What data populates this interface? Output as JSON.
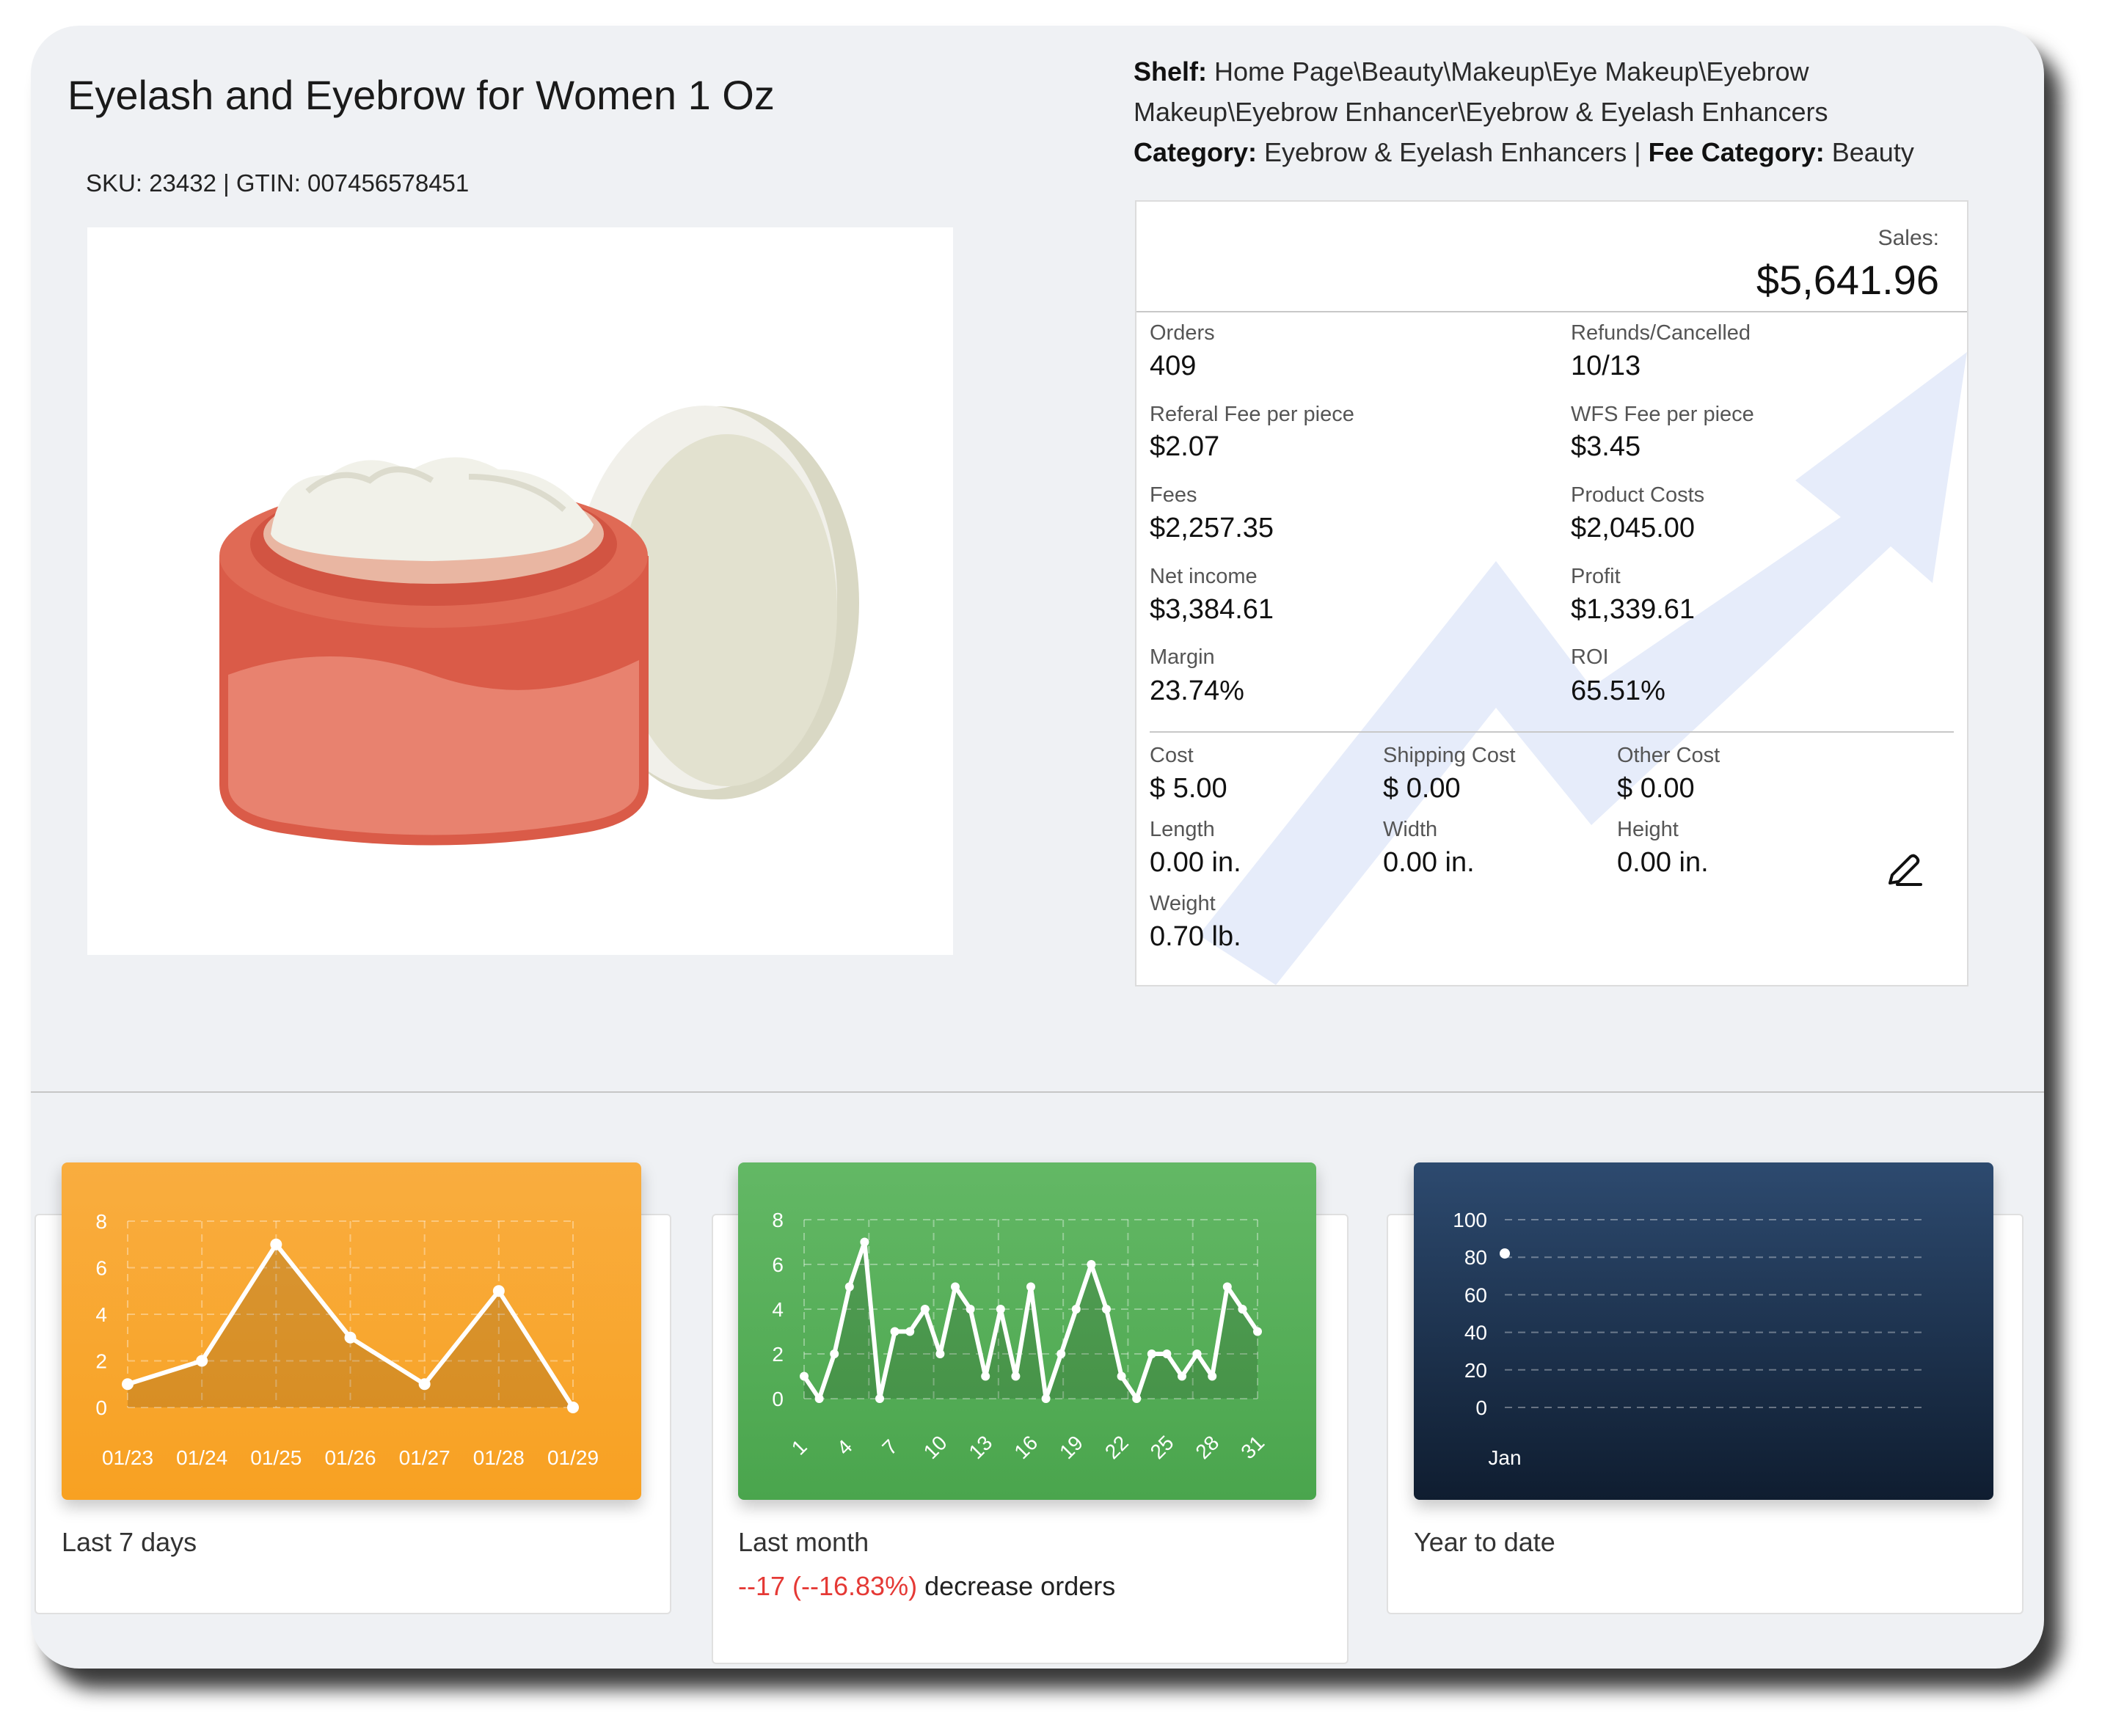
{
  "product": {
    "title": "Eyelash and Eyebrow for Women 1 Oz",
    "sku_line": "SKU: 23432 | GTIN: 007456578451",
    "image_icon": "cosmetic-jar-icon"
  },
  "shelf": {
    "shelf_label": "Shelf:",
    "shelf_value_1": " Home Page\\Beauty\\Makeup\\Eye Makeup\\Eyebrow",
    "shelf_value_2": "Makeup\\Eyebrow Enhancer\\Eyebrow & Eyelash Enhancers",
    "category_label": "Category:",
    "category_value": " Eyebrow & Eyelash Enhancers | ",
    "fee_category_label": "Fee Category:",
    "fee_category_value": " Beauty"
  },
  "stats": {
    "sales_label": "Sales:",
    "sales_value": "$5,641.96",
    "orders_label": "Orders",
    "orders_value": "409",
    "refunds_label": "Refunds/Cancelled",
    "refunds_value": "10/13",
    "referal_fee_label": "Referal Fee per piece",
    "referal_fee_value": "$2.07",
    "wfs_fee_label": "WFS Fee per piece",
    "wfs_fee_value": "$3.45",
    "fees_label": "Fees",
    "fees_value": "$2,257.35",
    "product_costs_label": "Product Costs",
    "product_costs_value": "$2,045.00",
    "net_income_label": "Net income",
    "net_income_value": "$3,384.61",
    "profit_label": "Profit",
    "profit_value": "$1,339.61",
    "margin_label": "Margin",
    "margin_value": "23.74%",
    "roi_label": "ROI",
    "roi_value": "65.51%",
    "cost_label": "Cost",
    "cost_value": "$ 5.00",
    "shipping_cost_label": "Shipping Cost",
    "shipping_cost_value": "$ 0.00",
    "other_cost_label": "Other Cost",
    "other_cost_value": "$ 0.00",
    "length_label": "Length",
    "length_value": "0.00 in.",
    "width_label": "Width",
    "width_value": "0.00 in.",
    "height_label": "Height",
    "height_value": "0.00 in.",
    "weight_label": "Weight",
    "weight_value": "0.70 lb.",
    "edit_icon": "pencil-edit-icon",
    "background_icon": "trend-up-arrow-icon"
  },
  "cards": {
    "card1": {
      "title": "Last 7 days",
      "color": "#f9a32b"
    },
    "card2": {
      "title": "Last month",
      "change_value": "--17 (--16.83%)",
      "change_text": " decrease orders",
      "color": "#4caf50",
      "change_color": "#e53935"
    },
    "card3": {
      "title": "Year to date",
      "color": "#1f3350"
    }
  },
  "chart_data": [
    {
      "type": "area",
      "x": [
        "01/23",
        "01/24",
        "01/25",
        "01/26",
        "01/27",
        "01/28",
        "01/29"
      ],
      "values": [
        1,
        2,
        7,
        3,
        1,
        5,
        0
      ],
      "yticks": [
        0,
        2,
        4,
        6,
        8
      ],
      "ylim": [
        0,
        8
      ],
      "grid": true
    },
    {
      "type": "area",
      "x": [
        1,
        2,
        3,
        4,
        5,
        6,
        7,
        8,
        9,
        10,
        11,
        12,
        13,
        14,
        15,
        16,
        17,
        18,
        19,
        20,
        21,
        22,
        23,
        24,
        25,
        26,
        27,
        28,
        29,
        30,
        31
      ],
      "xticks": [
        "1",
        "4",
        "7",
        "10",
        "13",
        "16",
        "19",
        "22",
        "25",
        "28",
        "31"
      ],
      "values": [
        1,
        0,
        2,
        5,
        7,
        0,
        3,
        3,
        4,
        2,
        5,
        4,
        1,
        4,
        1,
        5,
        0,
        2,
        4,
        6,
        4,
        1,
        0,
        2,
        2,
        1,
        2,
        1,
        5,
        4,
        3
      ],
      "yticks": [
        0,
        2,
        4,
        6,
        8
      ],
      "ylim": [
        0,
        8
      ],
      "grid": true
    },
    {
      "type": "line",
      "x": [
        "Jan"
      ],
      "values": [
        82
      ],
      "yticks": [
        0,
        20,
        40,
        60,
        80,
        100
      ],
      "ylim": [
        0,
        100
      ],
      "grid": true
    }
  ]
}
